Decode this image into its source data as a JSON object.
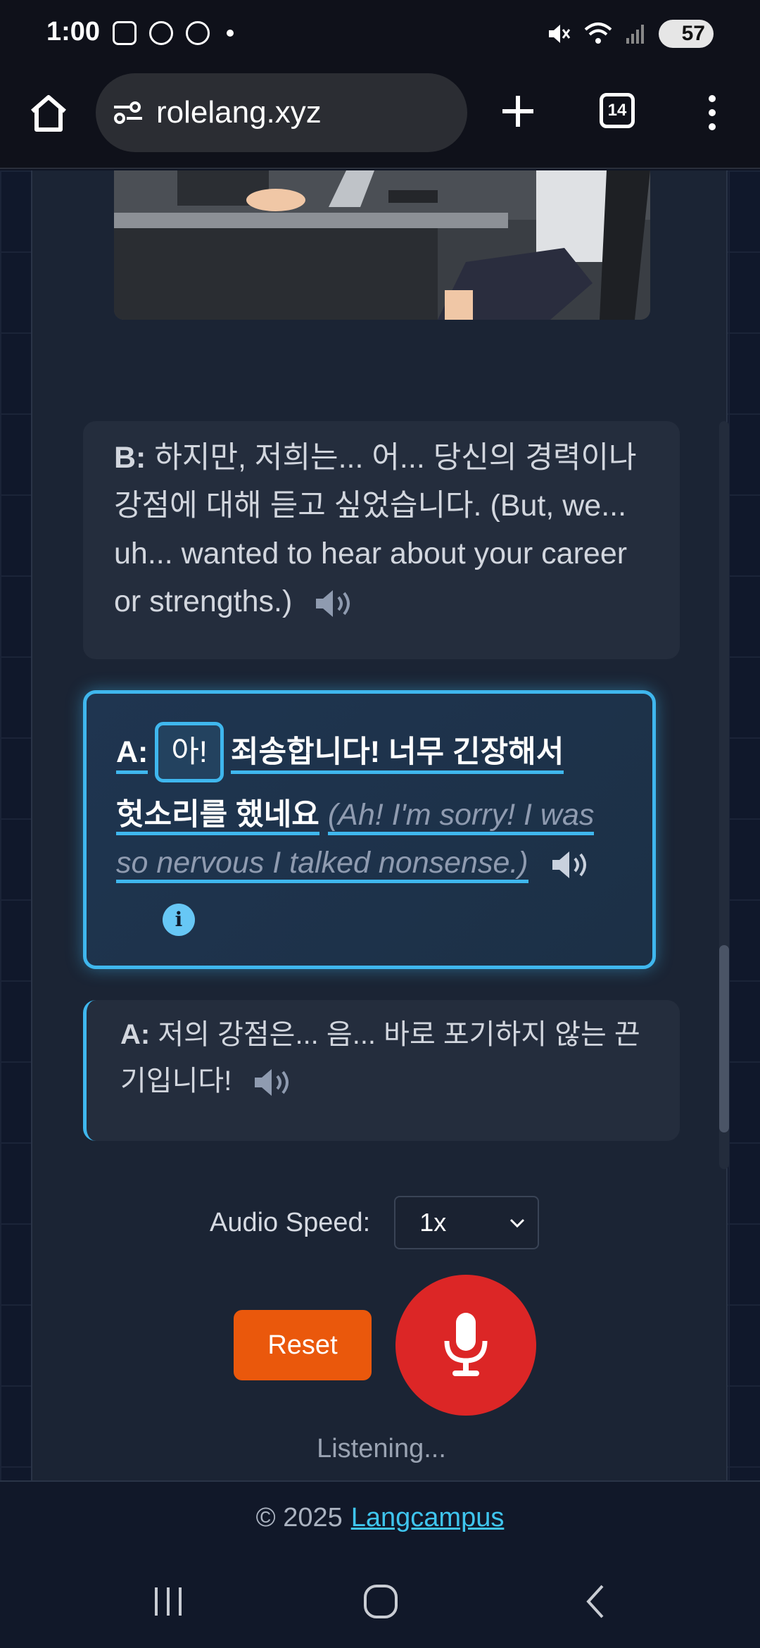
{
  "status_bar": {
    "time": "1:00",
    "battery": "57"
  },
  "browser": {
    "url": "rolelang.xyz",
    "tab_count": "14"
  },
  "dialogue": {
    "msg_b": {
      "speaker": "B:",
      "korean": "하지만, 저희는... 어... 당신의 경력이나 강점에 대해 듣고 싶었습니다.",
      "translation": "(But, we... uh... wanted to hear about your career or strengths.)"
    },
    "msg_active": {
      "speaker": "A:",
      "highlight_word": "아!",
      "korean_rest_line1": "죄송합니다! 너무 긴장해서",
      "korean_line2": "헛소리를 했네요",
      "translation": "(Ah! I'm sorry! I was so nervous I talked nonsense.)"
    },
    "msg_a2": {
      "speaker": "A:",
      "korean": "저의 강점은... 음... 바로 포기하지 않는 끈기입니다!"
    }
  },
  "controls": {
    "audio_speed_label": "Audio Speed:",
    "audio_speed_value": "1x",
    "reset_label": "Reset",
    "status_text": "Listening..."
  },
  "footer": {
    "copyright": "© 2025",
    "link_text": "Langcampus"
  },
  "colors": {
    "accent": "#3fb7ee",
    "reset": "#ea580c",
    "mic": "#dc2626"
  }
}
